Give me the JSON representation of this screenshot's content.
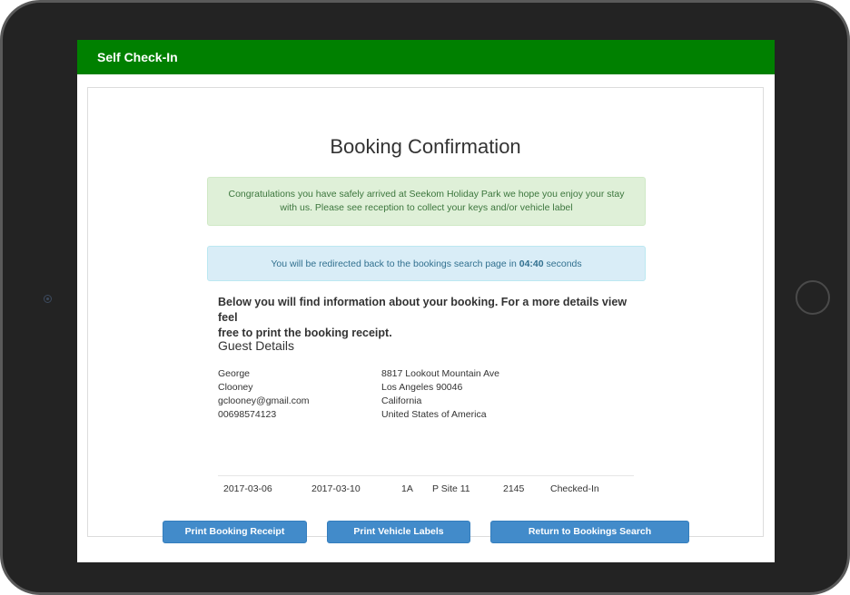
{
  "header": {
    "title": "Self Check-In"
  },
  "page": {
    "title": "Booking Confirmation"
  },
  "alerts": {
    "success_line1": "Congratulations you have safely arrived at Seekom Holiday Park we hope you enjoy your stay",
    "success_line2": "with us.  Please see reception to collect your keys and/or vehicle label",
    "redirect_prefix": "You will be redirected back to the bookings search page in ",
    "redirect_countdown": "04:40",
    "redirect_suffix": " seconds"
  },
  "intro": {
    "line1": "Below you will find information about your booking. For a more details view feel",
    "line2": "free to print the booking receipt."
  },
  "guest": {
    "heading": "Guest Details",
    "first_name": "George",
    "last_name": "Clooney",
    "email": "gclooney@gmail.com",
    "phone": "00698574123",
    "address1": "8817 Lookout Mountain Ave",
    "address2": "Los Angeles 90046",
    "region": "California",
    "country": "United States of America"
  },
  "booking": {
    "arrival": "2017-03-06",
    "departure": "2017-03-10",
    "unit": "1A",
    "site": "P Site 11",
    "number": "2145",
    "status": "Checked-In"
  },
  "buttons": {
    "print_receipt": "Print Booking Receipt",
    "print_labels": "Print Vehicle Labels",
    "return_search": "Return to Bookings Search"
  },
  "colors": {
    "header_bg": "#008000",
    "success_bg": "#dff0d8",
    "success_text": "#3c763d",
    "info_bg": "#d9edf7",
    "info_text": "#31708f",
    "button_bg": "#428bca"
  }
}
